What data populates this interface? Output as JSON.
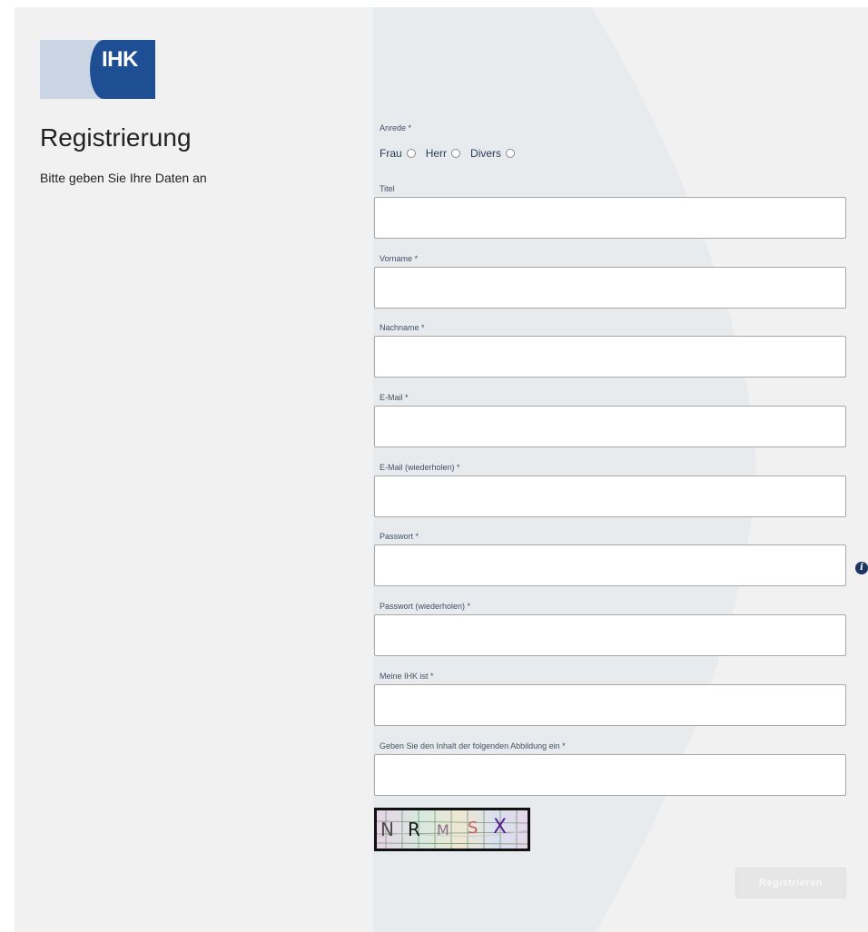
{
  "logo": {
    "text": "IHK"
  },
  "header": {
    "title": "Registrierung",
    "subtitle": "Bitte geben Sie Ihre Daten an"
  },
  "form": {
    "salutation": {
      "label": "Anrede *",
      "options": [
        "Frau",
        "Herr",
        "Divers"
      ],
      "selected": null
    },
    "fields": {
      "title": {
        "label": "Titel",
        "value": ""
      },
      "firstname": {
        "label": "Vorname *",
        "value": ""
      },
      "lastname": {
        "label": "Nachname *",
        "value": ""
      },
      "email": {
        "label": "E-Mail *",
        "value": ""
      },
      "email_repeat": {
        "label": "E-Mail (wiederholen) *",
        "value": ""
      },
      "password": {
        "label": "Passwort *",
        "value": ""
      },
      "password_repeat": {
        "label": "Passwort (wiederholen) *",
        "value": ""
      },
      "ihk": {
        "label": "Meine IHK ist *",
        "value": ""
      },
      "captcha": {
        "label": "Geben Sie den Inhalt der folgenden Abbildung ein *",
        "value": ""
      }
    },
    "captcha_image": {
      "chars": [
        "N",
        "R",
        "M",
        "S",
        "X"
      ]
    },
    "submit_label": "Registrieren"
  },
  "colors": {
    "brand_dark": "#1e4f94",
    "brand_light": "#cad6e3",
    "page_bg": "#f1f1f1",
    "label_text": "#3f5066",
    "info_icon": "#1c3662",
    "button_disabled": "#e6e6e6"
  },
  "icons": {
    "password_info": "info-icon"
  }
}
